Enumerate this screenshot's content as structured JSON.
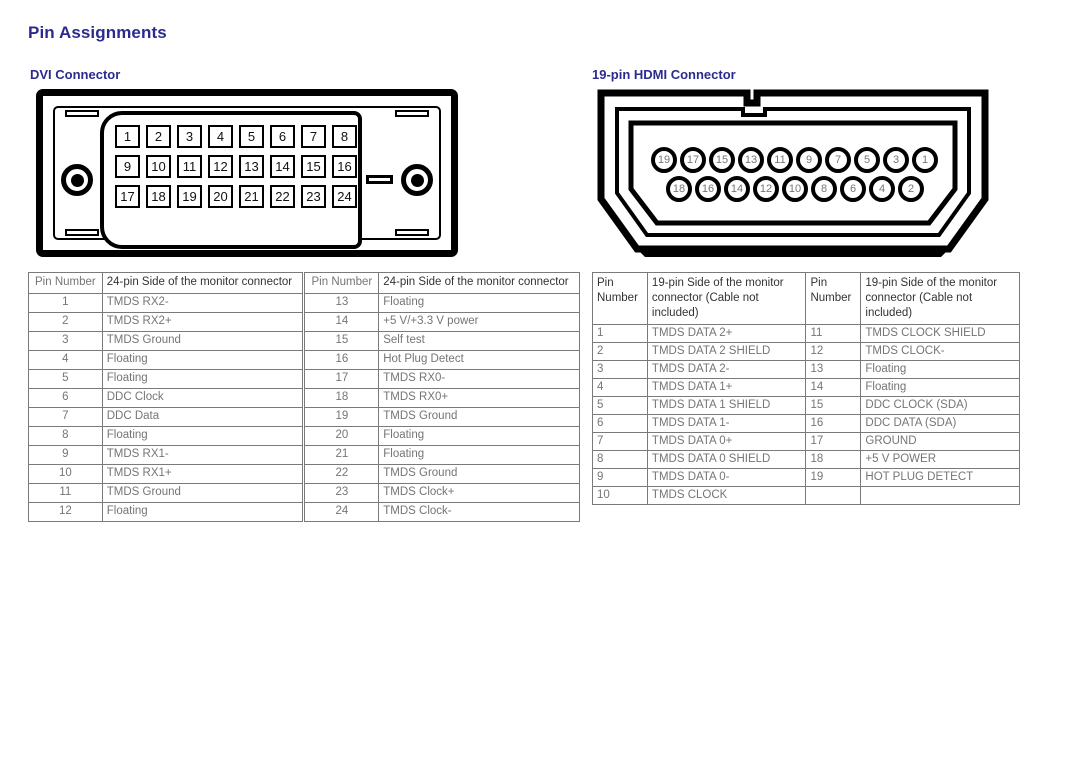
{
  "page_title": "Pin Assignments",
  "accent_color": "#2b2b8f",
  "sections": {
    "dvi": {
      "title": "DVI Connector",
      "diagram": {
        "name": "dvi-connector-diagram",
        "pins": [
          "1",
          "2",
          "3",
          "4",
          "5",
          "6",
          "7",
          "8",
          "9",
          "10",
          "11",
          "12",
          "13",
          "14",
          "15",
          "16",
          "17",
          "18",
          "19",
          "20",
          "21",
          "22",
          "23",
          "24"
        ],
        "rows": 3,
        "columns": 8
      },
      "table": {
        "headers": [
          "Pin Number",
          "24-pin Side of the monitor connector",
          "Pin Number",
          "24-pin Side of the monitor connector"
        ],
        "rows": [
          [
            "1",
            "TMDS RX2-",
            "13",
            "Floating"
          ],
          [
            "2",
            "TMDS RX2+",
            "14",
            "+5 V/+3.3 V power"
          ],
          [
            "3",
            "TMDS Ground",
            "15",
            "Self test"
          ],
          [
            "4",
            "Floating",
            "16",
            "Hot Plug Detect"
          ],
          [
            "5",
            "Floating",
            "17",
            "TMDS RX0-"
          ],
          [
            "6",
            "DDC Clock",
            "18",
            "TMDS RX0+"
          ],
          [
            "7",
            "DDC Data",
            "19",
            "TMDS Ground"
          ],
          [
            "8",
            "Floating",
            "20",
            "Floating"
          ],
          [
            "9",
            "TMDS RX1-",
            "21",
            "Floating"
          ],
          [
            "10",
            "TMDS RX1+",
            "22",
            "TMDS Ground"
          ],
          [
            "11",
            "TMDS Ground",
            "23",
            "TMDS Clock+"
          ],
          [
            "12",
            "Floating",
            "24",
            "TMDS Clock-"
          ]
        ]
      }
    },
    "hdmi": {
      "title": "19-pin HDMI  Connector",
      "diagram": {
        "name": "hdmi-connector-diagram",
        "odd_pins": [
          "19",
          "17",
          "15",
          "13",
          "11",
          "9",
          "7",
          "5",
          "3",
          "1"
        ],
        "even_pins": [
          "18",
          "16",
          "14",
          "12",
          "10",
          "8",
          "6",
          "4",
          "2"
        ]
      },
      "table": {
        "headers": [
          "Pin Number",
          "19-pin Side of the monitor connector (Cable not included)",
          "Pin Number",
          "19-pin Side of the monitor connector (Cable not included)"
        ],
        "rows": [
          [
            "1",
            "TMDS DATA 2+",
            "11",
            "TMDS CLOCK SHIELD"
          ],
          [
            "2",
            "TMDS DATA 2 SHIELD",
            "12",
            "TMDS CLOCK-"
          ],
          [
            "3",
            "TMDS DATA 2-",
            "13",
            "Floating"
          ],
          [
            "4",
            "TMDS DATA 1+",
            "14",
            "Floating"
          ],
          [
            "5",
            "TMDS DATA 1 SHIELD",
            "15",
            "DDC CLOCK (SDA)"
          ],
          [
            "6",
            "TMDS DATA 1-",
            "16",
            "DDC DATA (SDA)"
          ],
          [
            "7",
            "TMDS DATA 0+",
            "17",
            "GROUND"
          ],
          [
            "8",
            "TMDS DATA 0 SHIELD",
            "18",
            "+5 V POWER"
          ],
          [
            "9",
            "TMDS DATA 0-",
            "19",
            "HOT PLUG DETECT"
          ],
          [
            "10",
            "TMDS CLOCK",
            "",
            ""
          ]
        ]
      }
    }
  }
}
